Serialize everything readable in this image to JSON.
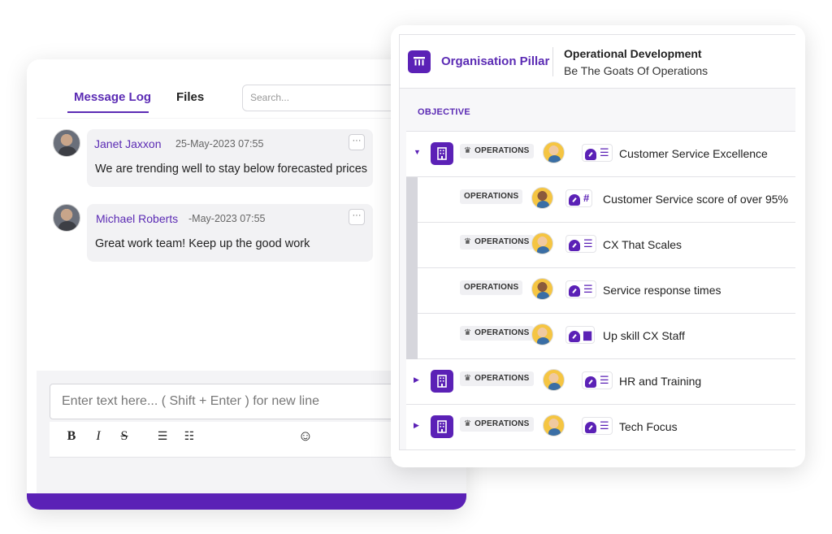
{
  "chat": {
    "tabs": {
      "message_log": "Message Log",
      "files": "Files"
    },
    "search_placeholder": "Search...",
    "messages": [
      {
        "author": "Janet Jaxxon",
        "time": "25-May-2023 07:55",
        "text": "We are trending well to stay below forecasted prices",
        "more": "···"
      },
      {
        "author": "Michael Roberts",
        "time": "-May-2023 07:55",
        "text": "Great work team! Keep up the good work",
        "more": "···"
      }
    ],
    "composer_placeholder": "Enter text here... ( Shift + Enter ) for new line",
    "toolbar": {
      "bold": "B",
      "italic": "I",
      "strike": "S",
      "bullet": "☰",
      "numbered": "☷",
      "emoji": "☺"
    }
  },
  "okr": {
    "pillar_icon": "pillar-icon",
    "pillar_title": "Organisation Pillar",
    "header_title": "Operational Development",
    "header_subtitle": "Be The Goats Of Operations",
    "column_label": "OBJECTIVE",
    "accent_color": "#5b21b6",
    "rows": [
      {
        "kind": "objective",
        "expanded": true,
        "owner": "OPERATIONS",
        "owner_crown": true,
        "title": "Customer Service Excellence",
        "type_icon": "list-icon",
        "caret": "▼"
      },
      {
        "kind": "key-result",
        "owner": "OPERATIONS",
        "owner_crown": false,
        "title": "Customer Service score of over 95%",
        "type_icon": "hash-icon"
      },
      {
        "kind": "key-result",
        "owner": "OPERATIONS",
        "owner_crown": true,
        "title": "CX That Scales",
        "type_icon": "list-icon"
      },
      {
        "kind": "key-result",
        "owner": "OPERATIONS",
        "owner_crown": false,
        "title": "Service response times",
        "type_icon": "list-icon"
      },
      {
        "kind": "key-result",
        "owner": "OPERATIONS",
        "owner_crown": true,
        "title": "Up skill CX Staff",
        "type_icon": "box-icon"
      },
      {
        "kind": "objective",
        "expanded": false,
        "owner": "OPERATIONS",
        "owner_crown": true,
        "title": "HR and Training",
        "type_icon": "list-icon",
        "caret": "▶"
      },
      {
        "kind": "objective",
        "expanded": false,
        "owner": "OPERATIONS",
        "owner_crown": true,
        "title": "Tech Focus",
        "type_icon": "list-icon",
        "caret": "▶"
      }
    ]
  }
}
